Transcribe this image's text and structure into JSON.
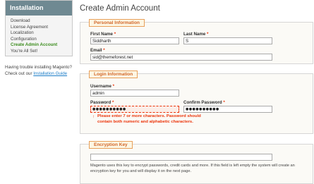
{
  "sidebar": {
    "title": "Installation",
    "steps": [
      {
        "label": "Download"
      },
      {
        "label": "License Agreement"
      },
      {
        "label": "Localization"
      },
      {
        "label": "Configuration"
      },
      {
        "label": "Create Admin Account"
      },
      {
        "label": "You're All Set!"
      }
    ],
    "active_step": "Create Admin Account",
    "help_text_1": "Having trouble installing Magento?",
    "help_text_2": "Check out our",
    "help_link": "Installation Guide"
  },
  "page": {
    "title": "Create Admin Account"
  },
  "personal": {
    "legend": "Personal Information",
    "first_name_label": "First Name",
    "first_name_value": "Siddharth",
    "last_name_label": "Last Name",
    "last_name_value": "S",
    "email_label": "Email",
    "email_value": "sid@themeforest.net",
    "required_mark": "*"
  },
  "login": {
    "legend": "Login Information",
    "username_label": "Username",
    "username_value": "admin",
    "password_label": "Password",
    "password_value": "●●●●●●●●●●",
    "confirm_label": "Confirm Password",
    "confirm_value": "●●●●●●●●●●",
    "error_icon": "↑",
    "error_message": "Please enter 7 or more characters. Password should contain both numeric and alphabetic characters."
  },
  "encryption": {
    "legend": "Encryption Key",
    "key_value": "",
    "note": "Magento uses this key to encrypt passwords, credit cards and more. If this field is left empty the system will create an encryption key for you and will display it on the next page."
  },
  "colors": {
    "accent_orange": "#d2672a",
    "error_red": "#eb340a",
    "active_green": "#3d8d1f",
    "header_slate": "#6f8992",
    "link_blue": "#1e7ec8"
  }
}
